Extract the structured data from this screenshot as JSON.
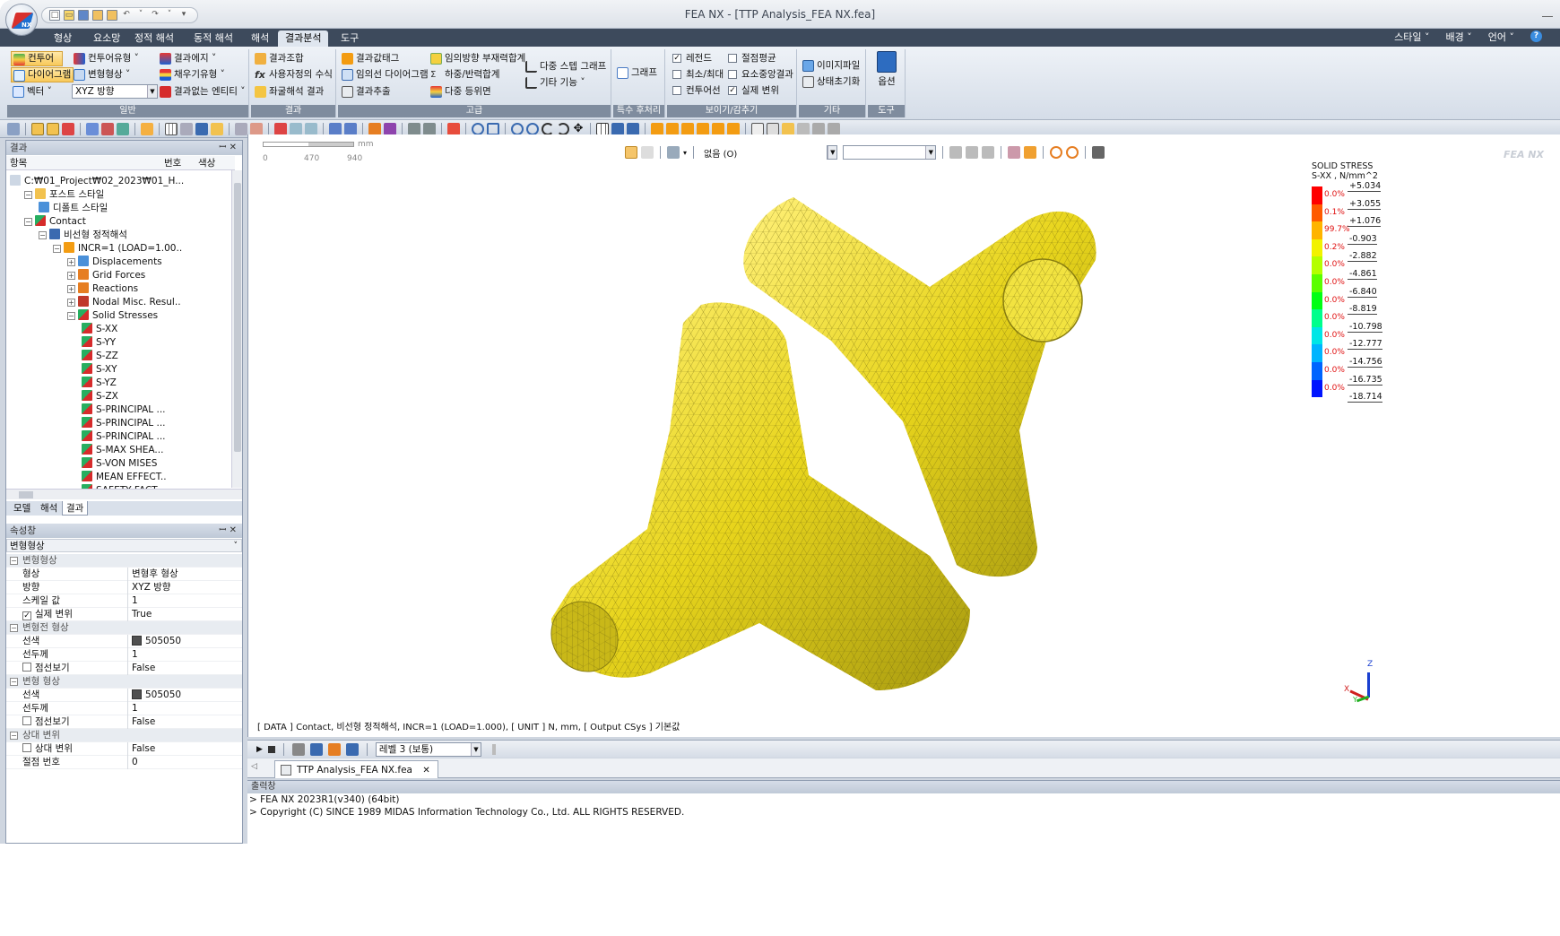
{
  "window": {
    "title": "FEA NX - [TTP Analysis_FEA NX.fea]"
  },
  "menu": {
    "tabs": [
      "형상",
      "요소망",
      "정적 해석",
      "동적 해석",
      "해석",
      "결과분석",
      "도구"
    ],
    "active_tab": "결과분석",
    "right": [
      "스타일 ˅",
      "배경 ˅",
      "언어 ˅"
    ]
  },
  "ribbon": {
    "groups": {
      "general": {
        "label": "일반",
        "contour": "컨투어",
        "diagram": "다이어그램",
        "vector": "벡터 ˅",
        "contour_type": "컨투어유형 ˅",
        "deformed": "변형형상 ˅",
        "direction_select": "XYZ 방향",
        "result_edge": "결과에지 ˅",
        "fill_type": "채우기유형 ˅",
        "no_result_entity": "결과없는 엔티티 ˅"
      },
      "result": {
        "label": "결과",
        "combination": "결과조합",
        "user_formula": "사용자정의 수식",
        "buckling": "좌굴해석 결과"
      },
      "advanced": {
        "label": "고급",
        "result_tag": "결과값태그",
        "arbitrary_diagram": "임의선 다이어그램",
        "result_extract": "결과추출",
        "member_sum": "임의방향 부재력합계",
        "load_reaction_sum": "하중/반력합계",
        "multi_iso": "다중 등위면",
        "multi_step_graph": "다중 스텝 그래프",
        "other_functions": "기타 기능 ˅"
      },
      "special": {
        "label": "특수 후처리",
        "graph": "그래프"
      },
      "display": {
        "label": "보이기/감추기",
        "legend": "레전드",
        "min_max": "최소/최대",
        "contour_line": "컨투어선",
        "node_avg": "절점평균",
        "elem_center": "요소중앙결과",
        "real_disp": "실제 변위"
      },
      "etc": {
        "label": "기타",
        "image_file": "이미지파일",
        "state_init": "상태초기화"
      },
      "tools": {
        "label": "도구",
        "options": "옵션"
      }
    }
  },
  "result_panel": {
    "title": "결과",
    "columns": [
      "항목",
      "번호",
      "색상"
    ],
    "tree": [
      {
        "label": "C:₩01_Project₩02_2023₩01_H...",
        "level": 0,
        "icon": "path-icon"
      },
      {
        "label": "포스트 스타일",
        "level": 1,
        "icon": "folder-icon"
      },
      {
        "label": "디폴트 스타일",
        "level": 2,
        "icon": "style-icon"
      },
      {
        "label": "Contact",
        "level": 1,
        "icon": "analysis-icon"
      },
      {
        "label": "비선형 정적해석",
        "level": 2,
        "icon": "nonlinear-icon"
      },
      {
        "label": "INCR=1 (LOAD=1.00..",
        "level": 3,
        "icon": "increment-icon"
      },
      {
        "label": "Displacements",
        "level": 4,
        "icon": "displacement-icon"
      },
      {
        "label": "Grid Forces",
        "level": 4,
        "icon": "force-icon"
      },
      {
        "label": "Reactions",
        "level": 4,
        "icon": "reaction-icon"
      },
      {
        "label": "Nodal Misc. Resul..",
        "level": 4,
        "icon": "nodal-icon"
      },
      {
        "label": "Solid Stresses",
        "level": 4,
        "icon": "stress-icon"
      },
      {
        "label": "S-XX",
        "level": 5,
        "icon": "stress-item-icon"
      },
      {
        "label": "S-YY",
        "level": 5,
        "icon": "stress-item-icon"
      },
      {
        "label": "S-ZZ",
        "level": 5,
        "icon": "stress-item-icon"
      },
      {
        "label": "S-XY",
        "level": 5,
        "icon": "stress-item-icon"
      },
      {
        "label": "S-YZ",
        "level": 5,
        "icon": "stress-item-icon"
      },
      {
        "label": "S-ZX",
        "level": 5,
        "icon": "stress-item-icon"
      },
      {
        "label": "S-PRINCIPAL ...",
        "level": 5,
        "icon": "stress-item-icon"
      },
      {
        "label": "S-PRINCIPAL ...",
        "level": 5,
        "icon": "stress-item-icon"
      },
      {
        "label": "S-PRINCIPAL ...",
        "level": 5,
        "icon": "stress-item-icon"
      },
      {
        "label": "S-MAX SHEA...",
        "level": 5,
        "icon": "stress-item-icon"
      },
      {
        "label": "S-VON MISES",
        "level": 5,
        "icon": "stress-item-icon"
      },
      {
        "label": "MEAN EFFECT..",
        "level": 5,
        "icon": "stress-item-icon"
      },
      {
        "label": "SAFETY FACT...",
        "level": 5,
        "icon": "stress-item-icon"
      }
    ],
    "tabs": [
      "모델",
      "해석",
      "결과"
    ],
    "active_tab": "결과"
  },
  "properties": {
    "title": "속성창",
    "selector": "변형형상",
    "rows": [
      {
        "type": "cat",
        "key": "변형형상"
      },
      {
        "type": "row",
        "key": "형상",
        "value": "변형후 형상"
      },
      {
        "type": "row",
        "key": "방향",
        "value": "XYZ 방향"
      },
      {
        "type": "row",
        "key": "스케일 값",
        "value": "1"
      },
      {
        "type": "check",
        "key": "실제 변위",
        "value": "True",
        "checked": true
      },
      {
        "type": "cat",
        "key": "변형전 형상"
      },
      {
        "type": "color",
        "key": "선색",
        "value": "505050"
      },
      {
        "type": "row",
        "key": "선두께",
        "value": "1"
      },
      {
        "type": "check",
        "key": "점선보기",
        "value": "False",
        "checked": false
      },
      {
        "type": "cat",
        "key": "변형 형상"
      },
      {
        "type": "color",
        "key": "선색",
        "value": "505050"
      },
      {
        "type": "row",
        "key": "선두께",
        "value": "1"
      },
      {
        "type": "check",
        "key": "점선보기",
        "value": "False",
        "checked": false
      },
      {
        "type": "cat",
        "key": "상대 변위"
      },
      {
        "type": "check",
        "key": "상대 변위",
        "value": "False",
        "checked": false
      },
      {
        "type": "row",
        "key": "절점 번호",
        "value": "0"
      }
    ]
  },
  "viewport": {
    "scale_unit": "mm",
    "scale_ticks": [
      "0",
      "470",
      "940"
    ],
    "view_select": "없음 (O)",
    "brand": "FEA NX",
    "model_color": "#e8d51c",
    "info_line": "[ DATA ] Contact, 비선형 정적해석, INCR=1 (LOAD=1.000), [ UNIT ] N, mm, [ Output CSys ] 기본값",
    "legend": {
      "title": "SOLID STRESS",
      "subtitle": "S-XX , N/mm^2",
      "values": [
        "+5.034",
        "+3.055",
        "+1.076",
        "-0.903",
        "-2.882",
        "-4.861",
        "-6.840",
        "-8.819",
        "-10.798",
        "-12.777",
        "-14.756",
        "-16.735",
        "-18.714"
      ],
      "percents": [
        "0.0%",
        "0.1%",
        "99.7%",
        "0.2%",
        "0.0%",
        "0.0%",
        "0.0%",
        "0.0%",
        "0.0%",
        "0.0%",
        "0.0%",
        "0.0%"
      ],
      "colors": [
        "#ff0000",
        "#ff5a00",
        "#ffb400",
        "#f2f200",
        "#b4ff00",
        "#5aff00",
        "#00ff14",
        "#00ff8c",
        "#00e6e6",
        "#00b4ff",
        "#0064ff",
        "#0014ff"
      ]
    },
    "axis": {
      "z": "Z",
      "x": "X",
      "y": "Y"
    }
  },
  "anim_bar": {
    "level_select": "레벨 3 (보통)"
  },
  "doc_tab": {
    "label": "TTP Analysis_FEA NX.fea"
  },
  "output": {
    "title": "출력창",
    "lines": [
      "> FEA NX 2023R1(v340) (64bit)",
      "> Copyright (C) SINCE 1989 MIDAS Information Technology Co., Ltd. ALL RIGHTS RESERVED."
    ]
  }
}
